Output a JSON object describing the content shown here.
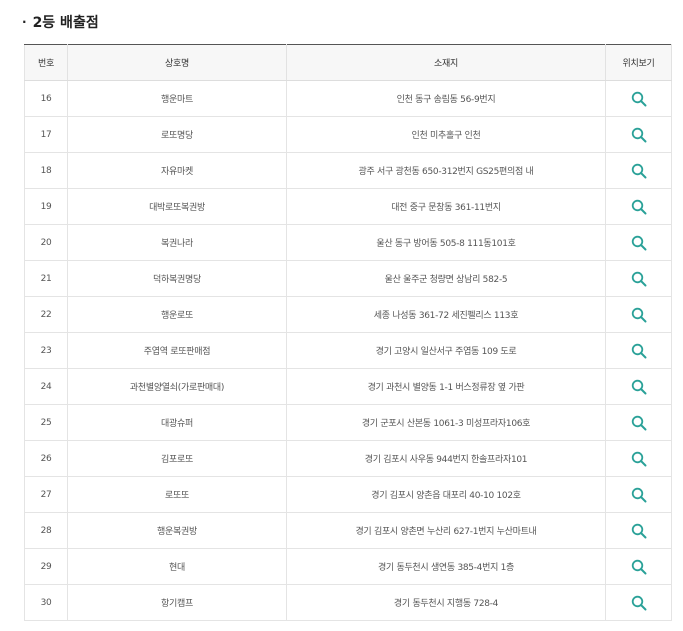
{
  "section": {
    "bullet": "·",
    "title": "2등 배출점"
  },
  "colors": {
    "accent": "#2aa198",
    "header_bg": "#f7f7f7"
  },
  "table": {
    "headers": [
      "번호",
      "상호명",
      "소재지",
      "위치보기"
    ],
    "rows": [
      {
        "no": "16",
        "name": "행운마트",
        "address": "인천 동구 송림동 56-9번지",
        "action_icon": "search-icon"
      },
      {
        "no": "17",
        "name": "로또명당",
        "address": "인천 미추홀구 인천",
        "action_icon": "search-icon"
      },
      {
        "no": "18",
        "name": "자유마켓",
        "address": "광주 서구 광천동 650-312번지 GS25편의점 내",
        "action_icon": "search-icon"
      },
      {
        "no": "19",
        "name": "대박로또복권방",
        "address": "대전 중구 문창동 361-11번지",
        "action_icon": "search-icon"
      },
      {
        "no": "20",
        "name": "복권나라",
        "address": "울산 동구 방어동 505-8 111동101호",
        "action_icon": "search-icon"
      },
      {
        "no": "21",
        "name": "덕하복권명당",
        "address": "울산 울주군 청량면 상남리 582-5",
        "action_icon": "search-icon"
      },
      {
        "no": "22",
        "name": "행운로또",
        "address": "세종 나성동 361-72 세진펠리스 113호",
        "action_icon": "search-icon"
      },
      {
        "no": "23",
        "name": "주엽역 로또판매점",
        "address": "경기 고양시 일산서구 주엽동 109 도로",
        "action_icon": "search-icon"
      },
      {
        "no": "24",
        "name": "과천별양열쇠(가로판매대)",
        "address": "경기 과천시 별양동 1-1 버스정류장 옆 가판",
        "action_icon": "search-icon"
      },
      {
        "no": "25",
        "name": "대광슈퍼",
        "address": "경기 군포시 산본동 1061-3 미성프라자106호",
        "action_icon": "search-icon"
      },
      {
        "no": "26",
        "name": "김포로또",
        "address": "경기 김포시 사우동 944번지 한솔프라자101",
        "action_icon": "search-icon"
      },
      {
        "no": "27",
        "name": "로또또",
        "address": "경기 김포시 양촌읍 대포리 40-10 102호",
        "action_icon": "search-icon"
      },
      {
        "no": "28",
        "name": "행운복권방",
        "address": "경기 김포시 양촌면 누산리 627-1번지 누산마트내",
        "action_icon": "search-icon"
      },
      {
        "no": "29",
        "name": "현대",
        "address": "경기 동두천시 생연동 385-4번지 1층",
        "action_icon": "search-icon"
      },
      {
        "no": "30",
        "name": "항기캠프",
        "address": "경기 동두천시 지행동 728-4",
        "action_icon": "search-icon"
      }
    ]
  }
}
